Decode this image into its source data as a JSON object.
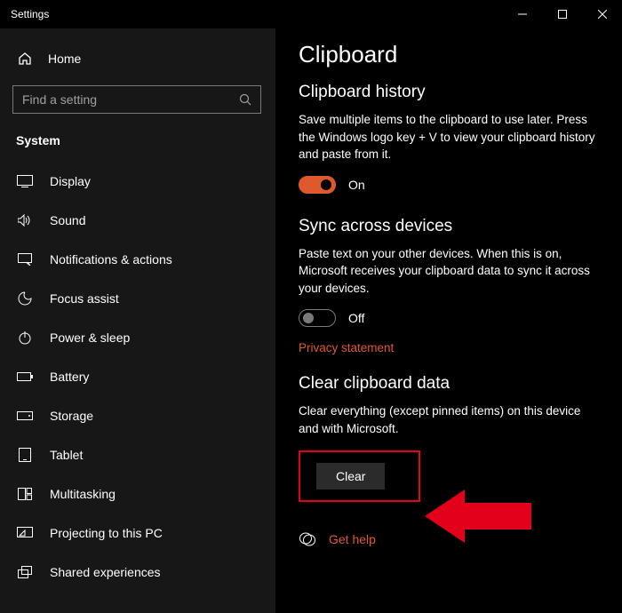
{
  "window": {
    "title": "Settings"
  },
  "sidebar": {
    "home": "Home",
    "search_placeholder": "Find a setting",
    "section": "System",
    "items": [
      {
        "label": "Display"
      },
      {
        "label": "Sound"
      },
      {
        "label": "Notifications & actions"
      },
      {
        "label": "Focus assist"
      },
      {
        "label": "Power & sleep"
      },
      {
        "label": "Battery"
      },
      {
        "label": "Storage"
      },
      {
        "label": "Tablet"
      },
      {
        "label": "Multitasking"
      },
      {
        "label": "Projecting to this PC"
      },
      {
        "label": "Shared experiences"
      }
    ]
  },
  "page": {
    "title": "Clipboard",
    "history": {
      "heading": "Clipboard history",
      "desc": "Save multiple items to the clipboard to use later. Press the Windows logo key + V to view your clipboard history and paste from it.",
      "toggle_state": "On"
    },
    "sync": {
      "heading": "Sync across devices",
      "desc": "Paste text on your other devices. When this is on, Microsoft receives your clipboard data to sync it across your devices.",
      "toggle_state": "Off",
      "privacy_link": "Privacy statement"
    },
    "clear": {
      "heading": "Clear clipboard data",
      "desc": "Clear everything (except pinned items) on this device and with Microsoft.",
      "button": "Clear"
    },
    "help": "Get help"
  }
}
